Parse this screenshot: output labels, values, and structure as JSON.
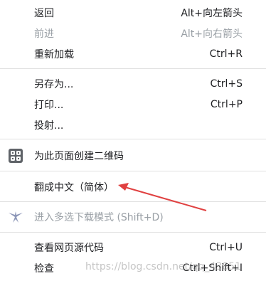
{
  "menu": {
    "items": [
      {
        "label": "返回",
        "shortcut": "Alt+向左箭头",
        "enabled": true
      },
      {
        "label": "前进",
        "shortcut": "Alt+向右箭头",
        "enabled": false
      },
      {
        "label": "重新加载",
        "shortcut": "Ctrl+R",
        "enabled": true
      },
      {
        "label": "另存为...",
        "shortcut": "Ctrl+S",
        "enabled": true
      },
      {
        "label": "打印...",
        "shortcut": "Ctrl+P",
        "enabled": true
      },
      {
        "label": "投射...",
        "shortcut": "",
        "enabled": true
      },
      {
        "label": "为此页面创建二维码",
        "shortcut": "",
        "enabled": true,
        "icon": "qr-code-icon"
      },
      {
        "label": "翻成中文（简体）",
        "shortcut": "",
        "enabled": true
      },
      {
        "label": "进入多选下载模式 (Shift+D)",
        "shortcut": "",
        "enabled": false,
        "icon": "swallow-download-icon"
      },
      {
        "label": "查看网页源代码",
        "shortcut": "Ctrl+U",
        "enabled": true
      },
      {
        "label": "检查",
        "shortcut": "Ctrl+Shift+I",
        "enabled": true
      }
    ]
  },
  "annotation": {
    "color": "#e04040",
    "points_to": "翻成中文（简体）"
  },
  "watermark": "https://blog.csdn.net/qq_43851"
}
